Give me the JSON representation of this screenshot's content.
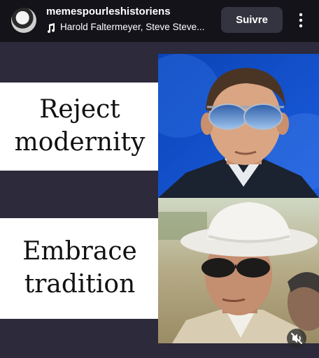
{
  "header": {
    "username": "memespourleshistoriens",
    "music": "Harold Faltermeyer, Steve Steve...",
    "follow_label": "Suivre"
  },
  "meme": {
    "panel1": {
      "line1": "Reject",
      "line2": "modernity"
    },
    "panel2": {
      "line1": "Embrace",
      "line2": "tradition"
    }
  },
  "colors": {
    "background": "#2c2a3b",
    "topbar": "#14131a",
    "follow_button": "#343441"
  },
  "icons": {
    "music": "music-note-icon",
    "more": "more-vertical-icon",
    "mute": "volume-muted-icon"
  }
}
